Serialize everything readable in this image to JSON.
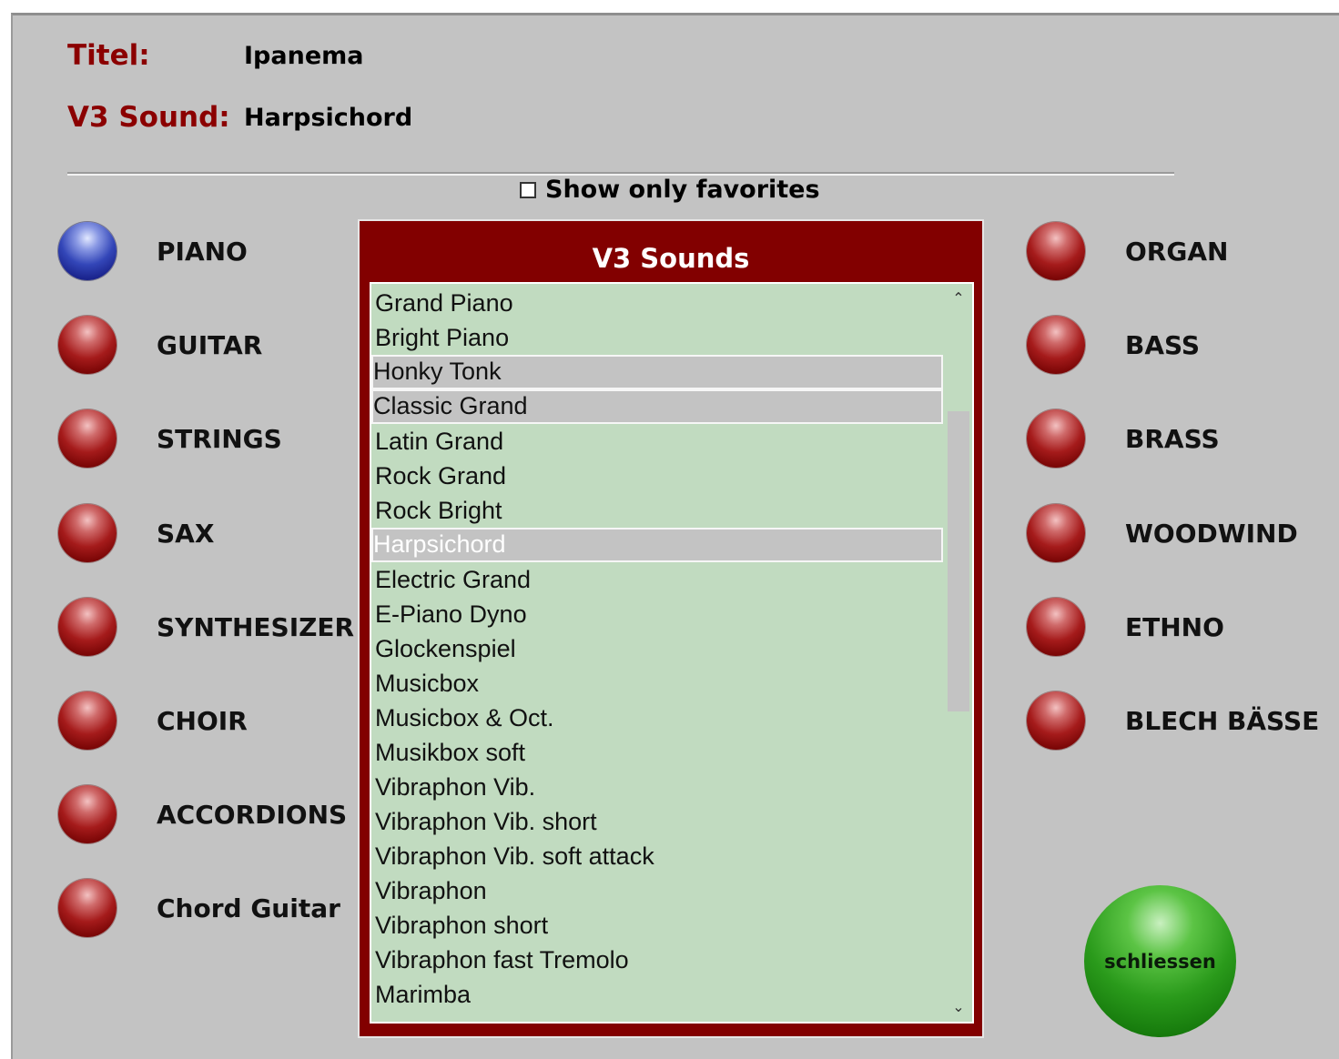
{
  "header": {
    "title_label": "Titel:",
    "title_value": "Ipanema",
    "sound_label": "V3 Sound:",
    "sound_value": "Harpsichord"
  },
  "favorites": {
    "label": "Show only favorites",
    "checked": false
  },
  "categories_left": [
    {
      "label": "PIANO",
      "active": true
    },
    {
      "label": "GUITAR",
      "active": false
    },
    {
      "label": "STRINGS",
      "active": false
    },
    {
      "label": "SAX",
      "active": false
    },
    {
      "label": "SYNTHESIZER",
      "active": false
    },
    {
      "label": "CHOIR",
      "active": false
    },
    {
      "label": "ACCORDIONS",
      "active": false
    },
    {
      "label": "Chord Guitar",
      "active": false
    }
  ],
  "categories_right": [
    {
      "label": "ORGAN",
      "active": false
    },
    {
      "label": "BASS",
      "active": false
    },
    {
      "label": "BRASS",
      "active": false
    },
    {
      "label": "WOODWIND",
      "active": false
    },
    {
      "label": "ETHNO",
      "active": false
    },
    {
      "label": "BLECH BÄSSE",
      "active": false
    }
  ],
  "sound_list": {
    "title": "V3 Sounds",
    "selected": "Harpsichord",
    "items": [
      {
        "label": "Grand Piano"
      },
      {
        "label": "Bright Piano"
      },
      {
        "label": "Honky Tonk",
        "highlight": true
      },
      {
        "label": "Classic Grand",
        "highlight": true
      },
      {
        "label": "Latin Grand"
      },
      {
        "label": "Rock Grand"
      },
      {
        "label": "Rock Bright"
      },
      {
        "label": "Harpsichord",
        "highlight": true,
        "selected": true
      },
      {
        "label": "Electric Grand"
      },
      {
        "label": "E-Piano Dyno"
      },
      {
        "label": "Glockenspiel"
      },
      {
        "label": "Musicbox"
      },
      {
        "label": "Musicbox & Oct."
      },
      {
        "label": "Musikbox soft"
      },
      {
        "label": "Vibraphon Vib."
      },
      {
        "label": "Vibraphon Vib. short"
      },
      {
        "label": "Vibraphon Vib. soft attack"
      },
      {
        "label": "Vibraphon"
      },
      {
        "label": "Vibraphon short"
      },
      {
        "label": "Vibraphon fast Tremolo"
      },
      {
        "label": "Marimba"
      }
    ]
  },
  "close_button": {
    "label": "schliessen"
  },
  "icons": {
    "scroll_up": "chevron-up-icon",
    "scroll_down": "chevron-down-icon"
  },
  "colors": {
    "panel_bg": "#c3c3c3",
    "accent_red": "#8b0000",
    "list_bg": "#c1dbc0",
    "list_frame": "#820000",
    "close_green": "#2a9a1b",
    "active_blue": "#3346b8"
  }
}
